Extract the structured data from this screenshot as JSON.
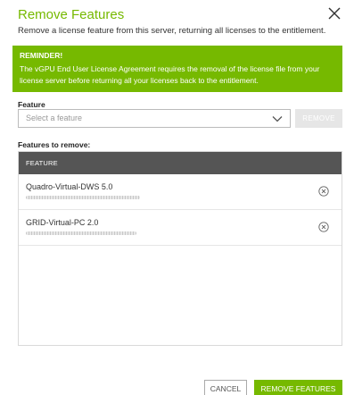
{
  "dialog": {
    "title": "Remove Features",
    "subtitle": "Remove a license feature from this server, returning all licenses to the entitlement.",
    "close_icon": "close-icon"
  },
  "reminder": {
    "title": "REMINDER!",
    "text": "The vGPU End User License Agreement requires the removal of the license file from your license server before returning all your licenses back to the entitlement."
  },
  "feature": {
    "label": "Feature",
    "placeholder": "Select a feature",
    "remove_label": "REMOVE"
  },
  "features_to_remove": {
    "label": "Features to remove:",
    "column_header": "FEATURE",
    "rows": [
      {
        "name": "Quadro-Virtual-DWS 5.0"
      },
      {
        "name": "GRID-Virtual-PC 2.0"
      }
    ]
  },
  "footer": {
    "cancel_label": "CANCEL",
    "submit_label": "REMOVE FEATURES"
  },
  "colors": {
    "accent": "#76b900",
    "header_bg": "#555555"
  }
}
